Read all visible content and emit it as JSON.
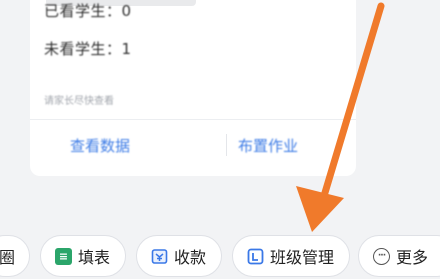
{
  "card": {
    "viewed": "已看学生：0",
    "unviewed": "未看学生：1",
    "note": "请家长尽快查看",
    "btn_view_data": "查看数据",
    "btn_assign": "布置作业"
  },
  "chips": [
    {
      "label": "圈",
      "icon": "circle-icon"
    },
    {
      "label": "填表",
      "icon": "form-icon"
    },
    {
      "label": "收款",
      "icon": "payment-icon"
    },
    {
      "label": "班级管理",
      "icon": "class-manage-icon"
    },
    {
      "label": "更多",
      "icon": "more-icon"
    }
  ],
  "colors": {
    "arrow": "#f07a2b",
    "link": "#3f7de6",
    "green_icon": "#2ba56a",
    "blue_icon": "#3a78e7"
  }
}
